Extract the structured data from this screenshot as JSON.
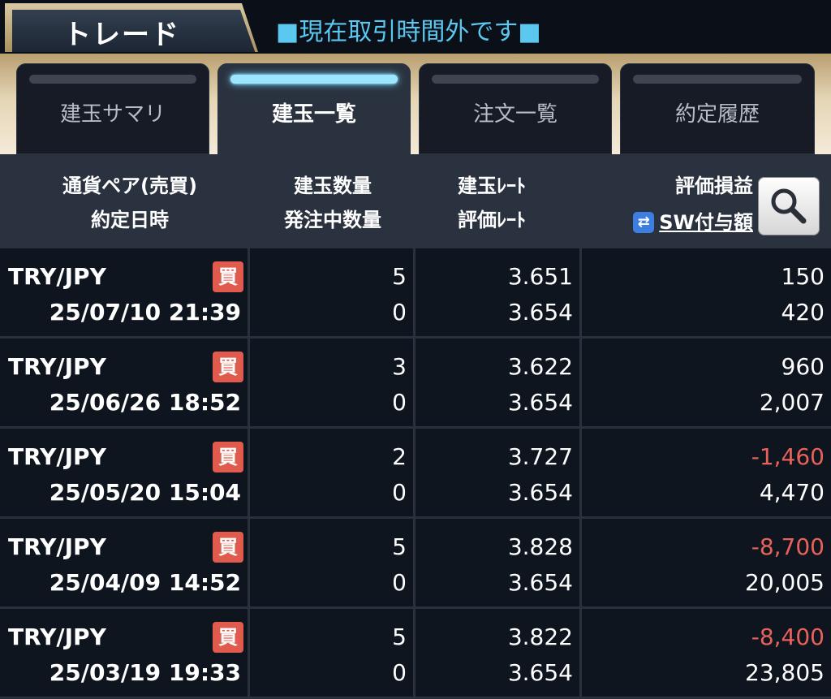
{
  "header": {
    "title": "トレード",
    "status": "■現在取引時間外です■"
  },
  "tabs": [
    {
      "label": "建玉サマリ",
      "active": false
    },
    {
      "label": "建玉一覧",
      "active": true
    },
    {
      "label": "注文一覧",
      "active": false
    },
    {
      "label": "約定履歴",
      "active": false
    }
  ],
  "columns": {
    "pair": "通貨ペア(売買)",
    "date": "約定日時",
    "qty": "建玉数量",
    "pending_qty": "発注中数量",
    "rate": "建玉ﾚｰﾄ",
    "eval_rate": "評価ﾚｰﾄ",
    "pnl": "評価損益",
    "sw": "SW付与額",
    "sw_icon": "⇄",
    "search_icon": "search-icon"
  },
  "colors": {
    "accent": "#5bc8f0",
    "buy_badge": "#e05a4e",
    "negative": "#e8625a",
    "sw_icon": "#3c7fe0"
  },
  "positions": [
    {
      "pair": "TRY/JPY",
      "side": "買",
      "datetime": "25/07/10 21:39",
      "qty": "5",
      "pending": "0",
      "rate": "3.651",
      "eval_rate": "3.654",
      "pnl": "150",
      "pnl_negative": false,
      "sw": "420"
    },
    {
      "pair": "TRY/JPY",
      "side": "買",
      "datetime": "25/06/26 18:52",
      "qty": "3",
      "pending": "0",
      "rate": "3.622",
      "eval_rate": "3.654",
      "pnl": "960",
      "pnl_negative": false,
      "sw": "2,007"
    },
    {
      "pair": "TRY/JPY",
      "side": "買",
      "datetime": "25/05/20 15:04",
      "qty": "2",
      "pending": "0",
      "rate": "3.727",
      "eval_rate": "3.654",
      "pnl": "-1,460",
      "pnl_negative": true,
      "sw": "4,470"
    },
    {
      "pair": "TRY/JPY",
      "side": "買",
      "datetime": "25/04/09 14:52",
      "qty": "5",
      "pending": "0",
      "rate": "3.828",
      "eval_rate": "3.654",
      "pnl": "-8,700",
      "pnl_negative": true,
      "sw": "20,005"
    },
    {
      "pair": "TRY/JPY",
      "side": "買",
      "datetime": "25/03/19 19:33",
      "qty": "5",
      "pending": "0",
      "rate": "3.822",
      "eval_rate": "3.654",
      "pnl": "-8,400",
      "pnl_negative": true,
      "sw": "23,805"
    }
  ]
}
